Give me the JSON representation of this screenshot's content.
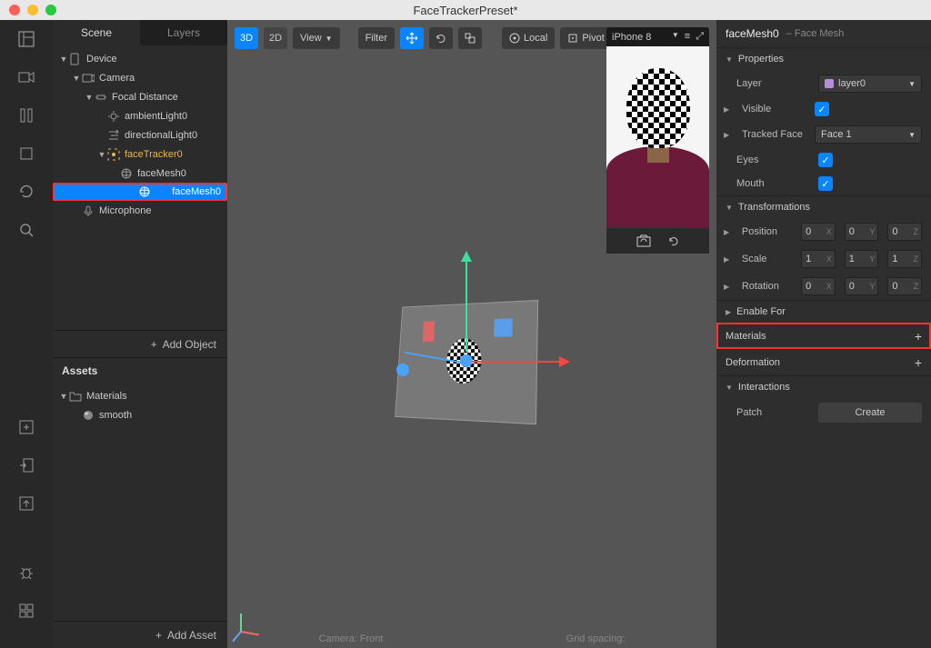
{
  "window": {
    "title": "FaceTrackerPreset*"
  },
  "scene_panel": {
    "tabs": [
      "Scene",
      "Layers"
    ],
    "active_tab": 0,
    "tree": [
      {
        "label": "Device",
        "indent": 0,
        "icon": "device",
        "expanded": true
      },
      {
        "label": "Camera",
        "indent": 1,
        "icon": "camera",
        "expanded": true
      },
      {
        "label": "Focal Distance",
        "indent": 2,
        "icon": "focal",
        "expanded": true
      },
      {
        "label": "ambientLight0",
        "indent": 3,
        "icon": "light",
        "leaf": true
      },
      {
        "label": "directionalLight0",
        "indent": 3,
        "icon": "dirlight",
        "leaf": true
      },
      {
        "label": "faceTracker0",
        "indent": 3,
        "icon": "facetrack",
        "expanded": true,
        "highlight_color": true
      },
      {
        "label": "faceMesh0",
        "indent": 4,
        "icon": "mesh",
        "leaf": true
      },
      {
        "label": "faceMesh0",
        "indent": 4,
        "icon": "mesh",
        "leaf": true,
        "selected": true,
        "highlight_box": true
      },
      {
        "label": "Microphone",
        "indent": 1,
        "icon": "mic",
        "leaf": true
      }
    ],
    "add_button": "Add Object"
  },
  "assets_panel": {
    "title": "Assets",
    "tree": [
      {
        "label": "Materials",
        "indent": 0,
        "icon": "folder",
        "expanded": true
      },
      {
        "label": "smooth",
        "indent": 1,
        "icon": "sphere",
        "leaf": true
      }
    ],
    "add_button": "Add Asset"
  },
  "viewport": {
    "mode_3d": "3D",
    "mode_2d": "2D",
    "view_label": "View",
    "filter_label": "Filter",
    "local_label": "Local",
    "pivot_label": "Pivot",
    "preview_device": "iPhone 8",
    "footer_camera": "Camera: Front",
    "footer_grid": "Grid spacing:"
  },
  "inspector": {
    "name": "faceMesh0",
    "type": "– Face Mesh",
    "sections": {
      "properties": "Properties",
      "transformations": "Transformations",
      "enable_for": "Enable For",
      "materials": "Materials",
      "deformation": "Deformation",
      "interactions": "Interactions"
    },
    "fields": {
      "layer_label": "Layer",
      "layer_value": "layer0",
      "visible_label": "Visible",
      "visible_value": true,
      "tracked_face_label": "Tracked Face",
      "tracked_face_value": "Face 1",
      "eyes_label": "Eyes",
      "eyes_value": true,
      "mouth_label": "Mouth",
      "mouth_value": true,
      "position_label": "Position",
      "position": {
        "x": "0",
        "y": "0",
        "z": "0"
      },
      "scale_label": "Scale",
      "scale": {
        "x": "1",
        "y": "1",
        "z": "1"
      },
      "rotation_label": "Rotation",
      "rotation": {
        "x": "0",
        "y": "0",
        "z": "0"
      },
      "patch_label": "Patch",
      "create_label": "Create"
    }
  }
}
